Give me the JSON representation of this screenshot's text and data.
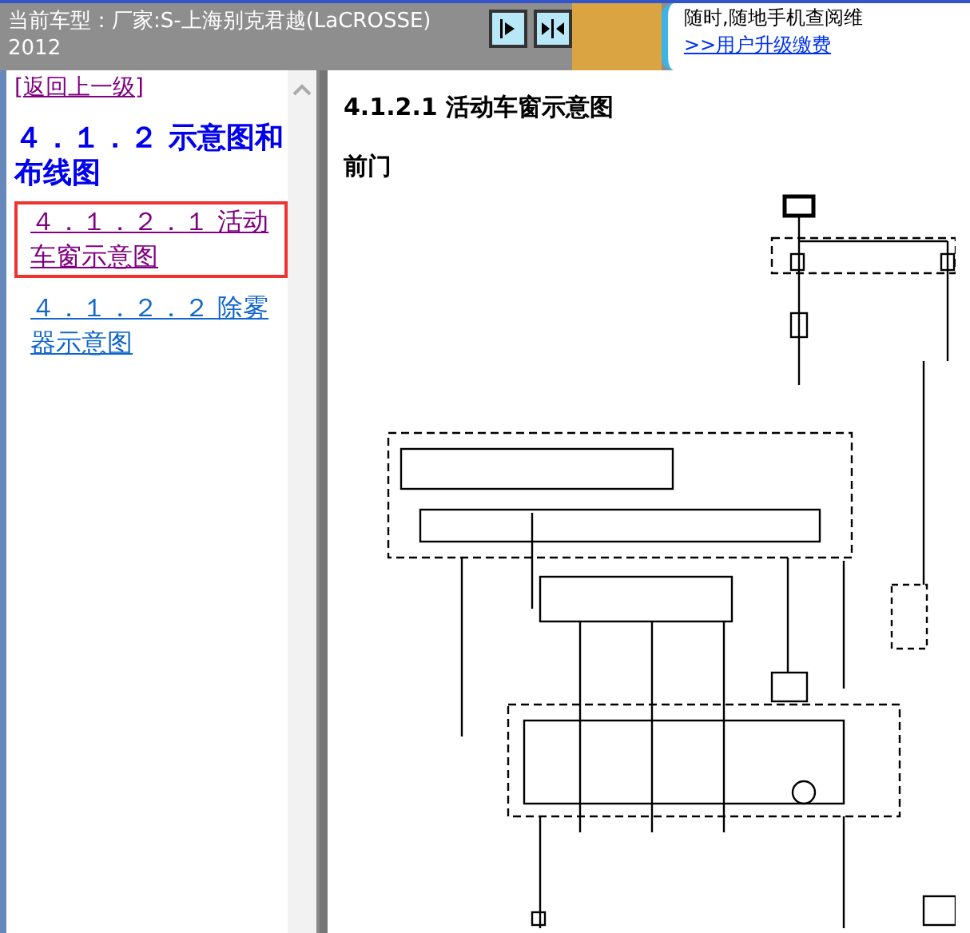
{
  "header": {
    "title_lines": [
      "当前车型：厂家:S-上海别克君越(LaCROSSE)",
      "2012"
    ],
    "ad_text": "随时,随地手机查阅维",
    "ad_link": ">>用户升级缴费"
  },
  "nav": {
    "back_link": "[返回上一级]",
    "items": [
      {
        "kind": "heading",
        "label": "４．１．２ 示意图和布线图",
        "selected": false
      },
      {
        "kind": "link",
        "label": "４．１．２．１ 活动车窗示意图",
        "selected": true
      },
      {
        "kind": "link",
        "label": "４．１．２．２ 除雾器示意图",
        "selected": false
      }
    ]
  },
  "content": {
    "title": "4.1.2.1 活动车窗示意图",
    "subtitle": "前门"
  }
}
